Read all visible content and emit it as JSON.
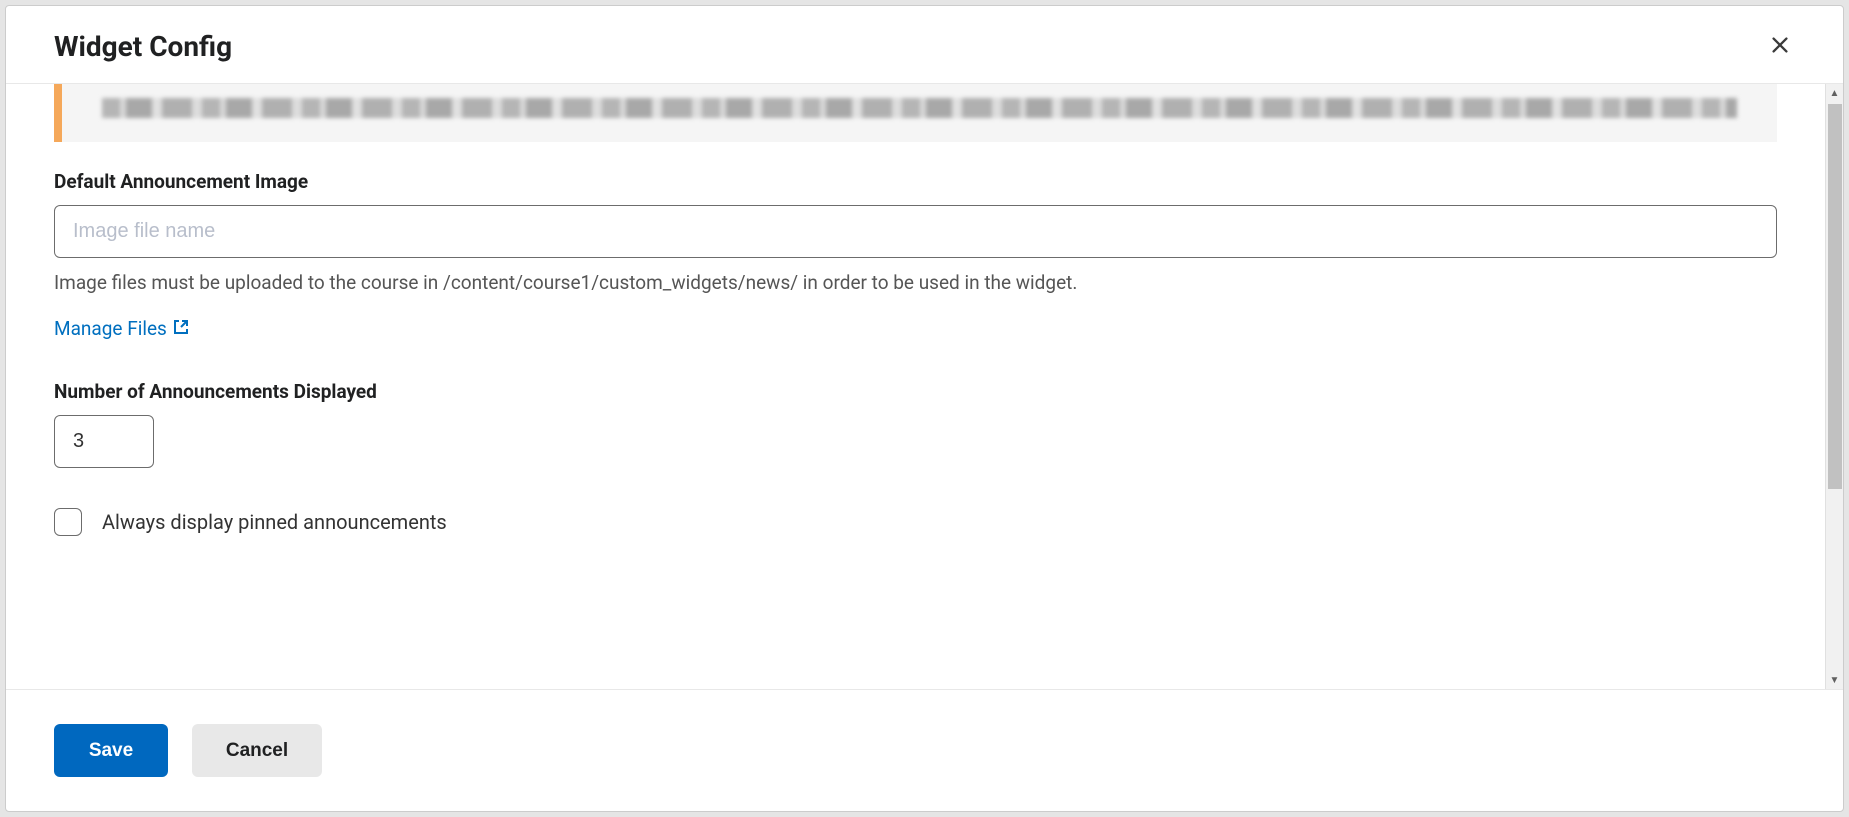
{
  "modal": {
    "title": "Widget Config"
  },
  "fields": {
    "image": {
      "label": "Default Announcement Image",
      "placeholder": "Image file name",
      "value": "",
      "help": "Image files must be uploaded to the course in /content/course1/custom_widgets/news/ in order to be used in the widget."
    },
    "manageFiles": {
      "label": "Manage Files"
    },
    "count": {
      "label": "Number of Announcements Displayed",
      "value": "3"
    },
    "pinned": {
      "label": "Always display pinned announcements",
      "checked": false
    }
  },
  "buttons": {
    "save": "Save",
    "cancel": "Cancel"
  }
}
